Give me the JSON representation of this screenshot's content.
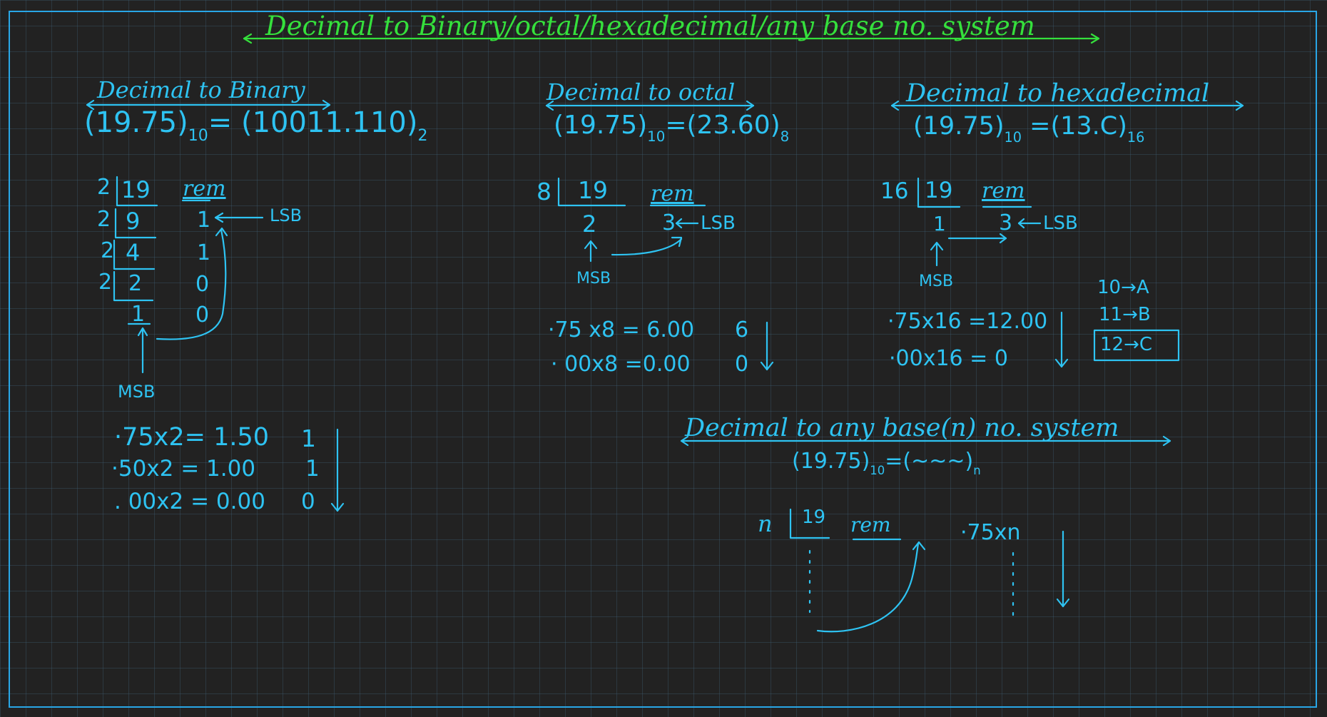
{
  "header_text": "",
  "title": "Decimal to Binary/octal/hexadecimal/any base no. system",
  "binary": {
    "heading": "Decimal to Binary",
    "equation_left": "(19.75)",
    "equation_left_base": "10",
    "equation_right": "= (10011.110)",
    "equation_right_base": "2",
    "divisors": [
      "2",
      "2",
      "2",
      "2"
    ],
    "dividends": [
      "19",
      "9",
      "4",
      "2",
      "1"
    ],
    "rem_label": "rem",
    "remainders": [
      "1",
      "1",
      "0",
      "0"
    ],
    "lsb": "LSB",
    "msb": "MSB",
    "fraction_rows": [
      {
        "expr": "·75x2= 1.50",
        "digit": "1"
      },
      {
        "expr": "·50x2 = 1.00",
        "digit": "1"
      },
      {
        "expr": ". 00x2 = 0.00",
        "digit": "0"
      }
    ]
  },
  "octal": {
    "heading": "Decimal to octal",
    "equation_left": "(19.75)",
    "equation_left_base": "10",
    "equation_right": "=(23.60)",
    "equation_right_base": "8",
    "divisor": "8",
    "dividend": "19",
    "quotient": "2",
    "rem_label": "rem",
    "remainder": "3",
    "lsb": "LSB",
    "msb": "MSB",
    "fraction_rows": [
      {
        "expr": "·75 x8 = 6.00",
        "digit": "6"
      },
      {
        "expr": "· 00x8 =0.00",
        "digit": "0"
      }
    ]
  },
  "hexadecimal": {
    "heading": "Decimal to hexadecimal",
    "equation_left": "(19.75)",
    "equation_left_base": "10",
    "equation_right": "=(13.C)",
    "equation_right_base": "16",
    "divisor": "16",
    "dividend": "19",
    "quotient": "1",
    "rem_label": "rem",
    "remainder": "3",
    "lsb": "LSB",
    "msb": "MSB",
    "fraction_rows": [
      {
        "expr": "·75x16 =12.00"
      },
      {
        "expr": "·00x16 = 0"
      }
    ],
    "mapping": [
      "10→A",
      "11→B",
      "12→C"
    ]
  },
  "any_base": {
    "heading": "Decimal to any base(n) no. system",
    "equation_left": "(19.75)",
    "equation_left_base": "10",
    "equation_right": "=(~~~)",
    "equation_right_base": "n",
    "divisor": "n",
    "dividend": "19",
    "rem_label": "rem",
    "fraction_expr": "·75xn"
  },
  "colors": {
    "background": "#222222",
    "grid": "#2f4a5e",
    "ink": "#2ec3f2",
    "title": "#35e03c",
    "border": "#29a6e6"
  }
}
